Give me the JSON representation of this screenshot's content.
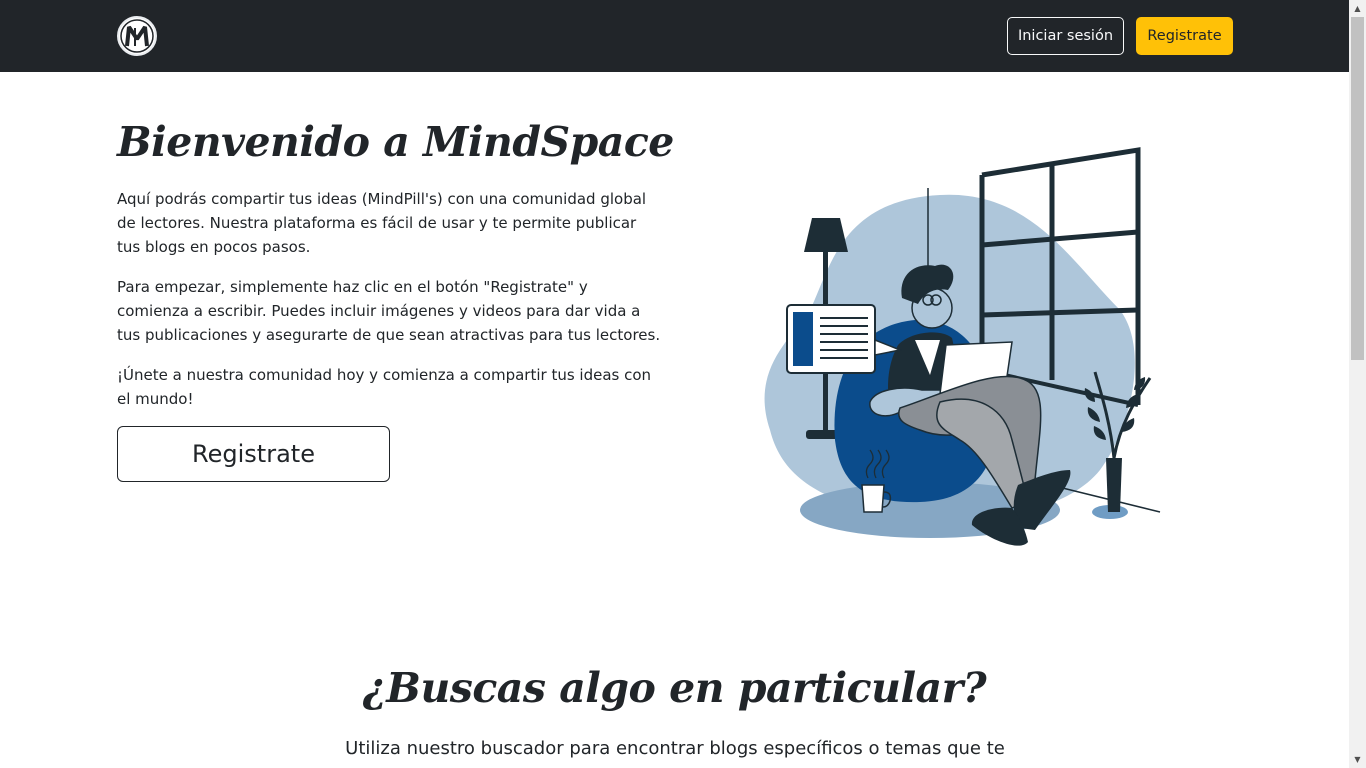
{
  "navbar": {
    "logo_alt": "MindSpace logo",
    "login_label": "Iniciar sesión",
    "register_label": "Registrate"
  },
  "hero": {
    "title": "Bienvenido a MindSpace",
    "paragraphs": [
      "Aquí podrás compartir tus ideas (MindPill's) con una comunidad global de lectores. Nuestra plataforma es fácil de usar y te permite publicar tus blogs en pocos pasos.",
      "Para empezar, simplemente haz clic en el botón \"Registrate\" y comienza a escribir. Puedes incluir imágenes y videos para dar vida a tus publicaciones y asegurarte de que sean atractivas para tus lectores.",
      "¡Únete a nuestra comunidad hoy y comienza a compartir tus ideas con el mundo!"
    ],
    "cta_label": "Registrate",
    "illustration_name": "person-reading-illustration"
  },
  "search_section": {
    "title": "¿Buscas algo en particular?",
    "description": "Utiliza nuestro buscador para encontrar blogs específicos o temas que te"
  },
  "colors": {
    "navbar_bg": "#212529",
    "accent_yellow": "#ffc107",
    "illustration_blue": "#0b4c8c",
    "illustration_light_blue": "#aec6da"
  }
}
